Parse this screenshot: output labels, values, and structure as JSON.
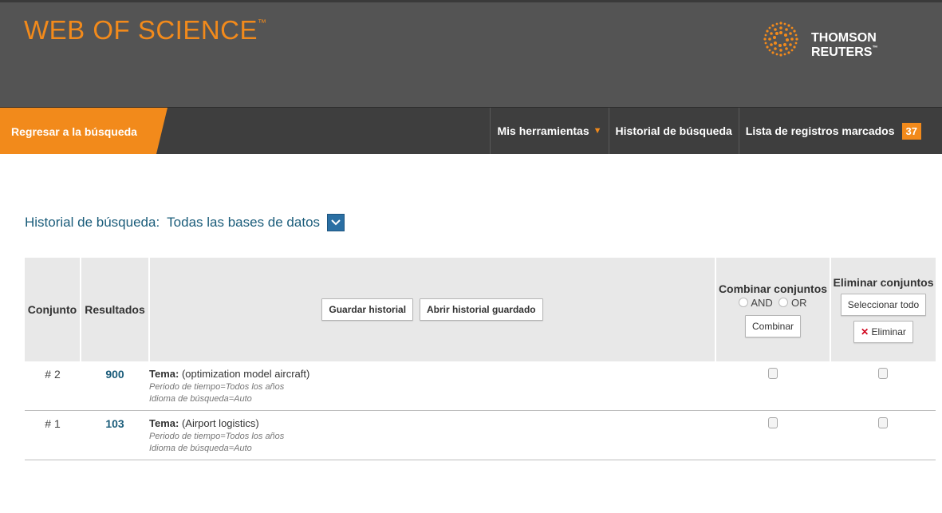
{
  "header": {
    "title": "WEB OF SCIENCE",
    "trademark": "™",
    "brand": "THOMSON REUTERS",
    "brand_trademark": "™",
    "accent_color": "#f28a1b"
  },
  "nav": {
    "back_label": "Regresar a la búsqueda",
    "tools_label": "Mis herramientas",
    "history_label": "Historial de búsqueda",
    "marked_label": "Lista de registros marcados",
    "marked_count": "37"
  },
  "history": {
    "title": "Historial de búsqueda:",
    "database": "Todas las bases de datos"
  },
  "table": {
    "col_set": "Conjunto",
    "col_results": "Resultados",
    "save_history": "Guardar historial",
    "open_history": "Abrir historial guardado",
    "combine_title": "Combinar conjuntos",
    "and_label": "AND",
    "or_label": "OR",
    "combine_button": "Combinar",
    "delete_title": "Eliminar conjuntos",
    "select_all": "Seleccionar todo",
    "delete_button": "Eliminar",
    "rows": [
      {
        "set": "# 2",
        "results": "900",
        "topic_label": "Tema:",
        "topic": "(optimization model aircraft)",
        "period": "Periodo de tiempo=Todos los años",
        "language": "Idioma de búsqueda=Auto"
      },
      {
        "set": "# 1",
        "results": "103",
        "topic_label": "Tema:",
        "topic": "(Airport logistics)",
        "period": "Periodo de tiempo=Todos los años",
        "language": "Idioma de búsqueda=Auto"
      }
    ]
  }
}
